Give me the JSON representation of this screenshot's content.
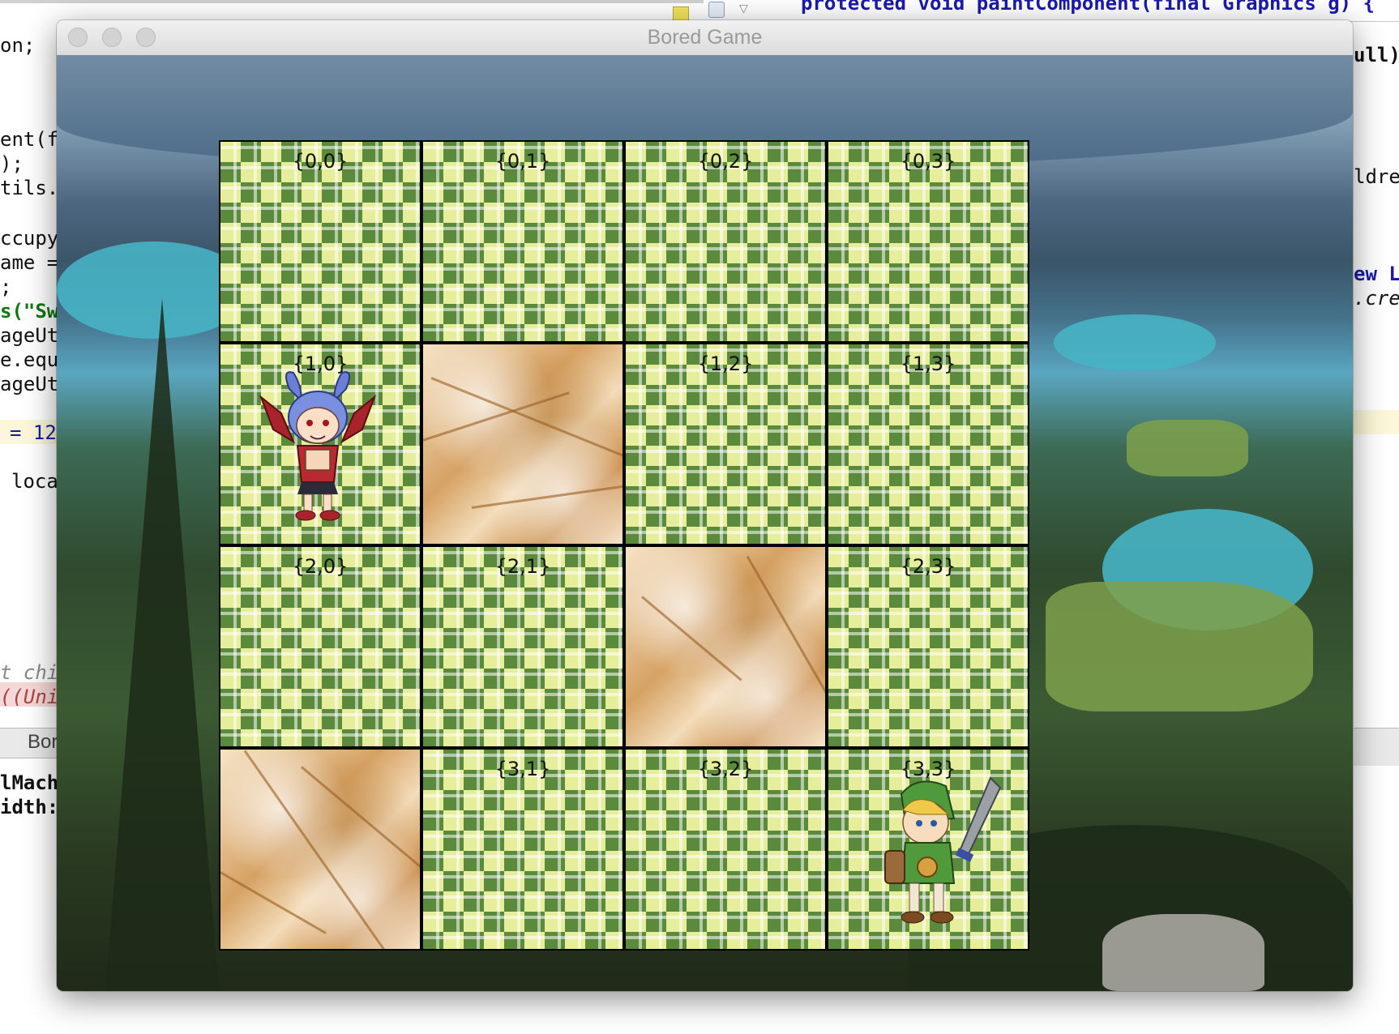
{
  "window": {
    "title": "Bored Game"
  },
  "board": {
    "rows": [
      [
        {
          "type": "grass",
          "label": "{0,0}"
        },
        {
          "type": "grass",
          "label": "{0,1}"
        },
        {
          "type": "grass",
          "label": "{0,2}"
        },
        {
          "type": "grass",
          "label": "{0,3}"
        }
      ],
      [
        {
          "type": "grass",
          "label": "{1,0}",
          "sprite": "disgaea-girl-sprite"
        },
        {
          "type": "sand",
          "label": ""
        },
        {
          "type": "grass",
          "label": "{1,2}"
        },
        {
          "type": "grass",
          "label": "{1,3}"
        }
      ],
      [
        {
          "type": "grass",
          "label": "{2,0}"
        },
        {
          "type": "grass",
          "label": "{2,1}"
        },
        {
          "type": "sand",
          "label": ""
        },
        {
          "type": "grass",
          "label": "{2,3}"
        }
      ],
      [
        {
          "type": "sand",
          "label": ""
        },
        {
          "type": "grass",
          "label": "{3,1}"
        },
        {
          "type": "grass",
          "label": "{3,2}"
        },
        {
          "type": "grass",
          "label": "{3,3}",
          "sprite": "link-sprite"
        }
      ]
    ]
  },
  "ide": {
    "top_code": "protected void paintComponent(final Graphics g) {",
    "left_lines": [
      "on;",
      "ent(f",
      ");",
      "tils.",
      "ccupy",
      "ame =",
      ";",
      "s(\"Sw",
      "ageUt",
      "e.equ",
      "ageUt",
      "= 12",
      "loca",
      "t chi",
      "((Uni",
      "Bor",
      "lMach:",
      "idth:("
    ],
    "right_lines": [
      "ull)",
      "ldre",
      "ew L",
      ".cre"
    ]
  },
  "colors": {
    "title_text": "#9a9a9a",
    "grid_line": "#000000",
    "grass_dark": "#5b8a3c",
    "grass_light": "#e6ee9c",
    "sand": "#d6a264"
  }
}
